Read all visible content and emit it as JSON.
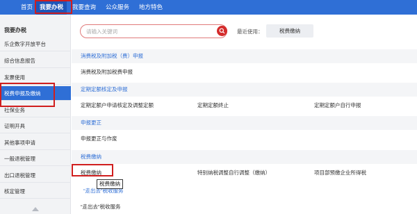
{
  "topnav": {
    "items": [
      {
        "label": "首页"
      },
      {
        "label": "我要办税"
      },
      {
        "label": "我要查询"
      },
      {
        "label": "公众服务"
      },
      {
        "label": "地方特色"
      }
    ]
  },
  "sidebar": {
    "title": "我要办税",
    "items": [
      {
        "label": "乐企数字开放平台"
      },
      {
        "label": "综合信息报告"
      },
      {
        "label": "发票使用"
      },
      {
        "label": "税费申报及缴纳"
      },
      {
        "label": "社保业务"
      },
      {
        "label": "证明开具"
      },
      {
        "label": "其他事项申请"
      },
      {
        "label": "一般退税管理"
      },
      {
        "label": "出口退税管理"
      },
      {
        "label": "核定管理"
      }
    ]
  },
  "search": {
    "placeholder": "请输入关键词",
    "icon": "search-icon"
  },
  "recent": {
    "label": "最近使用：",
    "item": "税费缴纳"
  },
  "sections": [
    {
      "title": "消费税及附加税（费）申报",
      "links": [
        "消费税及附加税费申报"
      ]
    },
    {
      "title": "定期定额核定及申报",
      "links": [
        "定期定额户申请核定及调整定额",
        "定期定额终止",
        "定期定额户自行申报"
      ]
    },
    {
      "title": "申报更正",
      "links": [
        "申报更正与作废"
      ]
    },
    {
      "title": "税费缴纳",
      "links": [
        "税费缴纳",
        "特别纳税调整自行调整（缴纳）",
        "项目部预缴企业所得税"
      ]
    }
  ],
  "extra_links": [
    "“走出去”税收服务",
    "“走出去”税收服务"
  ],
  "tooltip": "税费缴纳",
  "colors": {
    "primary": "#2f6fd6",
    "highlight": "#d01e1e"
  }
}
